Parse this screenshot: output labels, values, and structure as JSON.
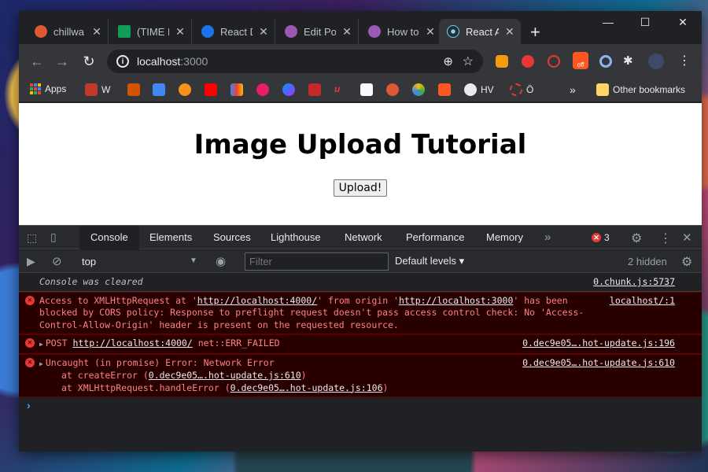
{
  "tabs": [
    {
      "title": "chillwa",
      "favicon_color": "#de5833"
    },
    {
      "title": "(TIME D",
      "favicon_color": "#0f9d58"
    },
    {
      "title": "React D",
      "favicon_color": "#1a73e8"
    },
    {
      "title": "Edit Po",
      "favicon_color": "#9b59b6"
    },
    {
      "title": "How to",
      "favicon_color": "#9b59b6"
    },
    {
      "title": "React A",
      "favicon_color": "#61dafb"
    }
  ],
  "address_bar": {
    "host": "localhost",
    "port": ":3000"
  },
  "bookmarks": {
    "apps_label": "Apps",
    "w_label": "W",
    "hv_label": "HV",
    "o_label": "Ö",
    "overflow_label": "»",
    "other_label": "Other bookmarks"
  },
  "extension_badge": "off",
  "page": {
    "title": "Image Upload Tutorial",
    "upload_button": "Upload!"
  },
  "devtools": {
    "tabs": [
      "Console",
      "Elements",
      "Sources",
      "Lighthouse",
      "Network",
      "Performance",
      "Memory"
    ],
    "more_tabs": "»",
    "error_count": "3",
    "context": "top",
    "filter_placeholder": "Filter",
    "levels": "Default levels ▾",
    "hidden": "2 hidden"
  },
  "console": {
    "cleared": {
      "text": "Console was cleared",
      "source": "0.chunk.js:5737"
    },
    "cors": {
      "prefix": "Access to XMLHttpRequest at '",
      "url1": "http://localhost:4000/",
      "mid": "' from origin '",
      "url2": "http://localhost:3000",
      "suffix": "' has been blocked by CORS policy: Response to preflight request doesn't pass access control check: No 'Access-Control-Allow-Origin' header is present on the requested resource.",
      "source": "localhost/:1"
    },
    "post": {
      "method": "POST ",
      "url": "http://localhost:4000/",
      "err": " net::ERR_FAILED",
      "source": "0.dec9e05….hot-update.js:196"
    },
    "uncaught": {
      "line1": "Uncaught (in promise) Error: Network Error",
      "line2_prefix": "at createError (",
      "line2_link": "0.dec9e05….hot-update.js:610",
      "line2_suffix": ")",
      "line3_prefix": "at XMLHttpRequest.handleError (",
      "line3_link": "0.dec9e05….hot-update.js:106",
      "line3_suffix": ")",
      "source": "0.dec9e05….hot-update.js:610"
    },
    "prompt": "›"
  }
}
